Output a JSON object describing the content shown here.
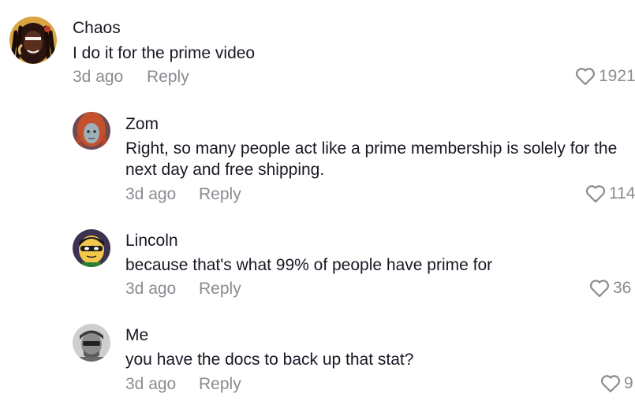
{
  "comments": [
    {
      "username": "Chaos",
      "text": "I do it for the prime video",
      "time": "3d ago",
      "reply_label": "Reply",
      "likes": "1921",
      "avatar_icon": "dreadlocks-avatar"
    },
    {
      "username": "Zom",
      "text": "Right, so many people act like a prime membership is solely for the next day and free shipping.",
      "time": "3d ago",
      "reply_label": "Reply",
      "likes": "114",
      "avatar_icon": "red-hair-zombie-avatar"
    },
    {
      "username": "Lincoln",
      "text": "because that's what 99% of people have prime for",
      "time": "3d ago",
      "reply_label": "Reply",
      "likes": "36",
      "avatar_icon": "lego-robin-avatar"
    },
    {
      "username": "Me",
      "text": "you have the docs to back up that stat?",
      "time": "3d ago",
      "reply_label": "Reply",
      "likes": "9",
      "avatar_icon": "grayscale-photo-avatar"
    }
  ],
  "colors": {
    "text": "#161823",
    "muted": "#8a8b91"
  }
}
